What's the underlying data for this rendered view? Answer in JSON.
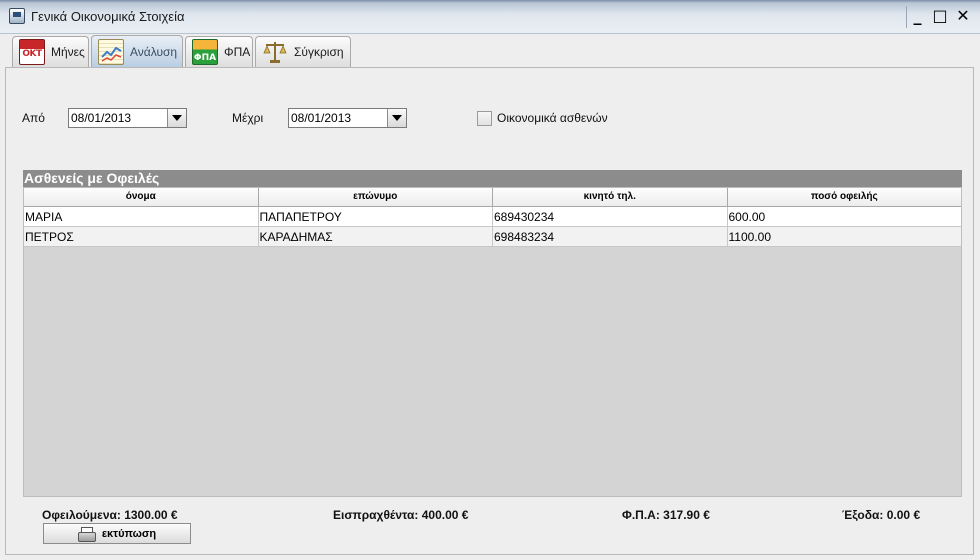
{
  "window": {
    "title": "Γενικά Οικονομικά Στοιχεία",
    "minimize": "_",
    "maximize": "□",
    "close": "✕"
  },
  "tabs": [
    {
      "label": "Μήνες",
      "icon": "calendar-icon",
      "icon_text": "ΟΚΤ",
      "active": false
    },
    {
      "label": "Ανάλυση",
      "icon": "chart-icon",
      "active": true
    },
    {
      "label": "ΦΠΑ",
      "icon": "vat-icon",
      "icon_text": "ΦΠΑ",
      "active": false
    },
    {
      "label": "Σύγκριση",
      "icon": "scale-icon",
      "active": false
    }
  ],
  "filters": {
    "from_label": "Από",
    "from_value": "08/01/2013",
    "to_label": "Μέχρι",
    "to_value": "08/01/2013",
    "checkbox_label": "Οικονομικά ασθενών",
    "checkbox_checked": false
  },
  "table": {
    "title": "Ασθενείς με Οφειλές",
    "columns": [
      "όνομα",
      "επώνυμο",
      "κινητό τηλ.",
      "ποσό οφειλής"
    ],
    "rows": [
      [
        "ΜΑΡΙΑ",
        "ΠΑΠΑΠΕΤΡΟΥ",
        "689430234",
        "600.00"
      ],
      [
        "ΠΕΤΡΟΣ",
        "ΚΑΡΑΔΗΜΑΣ",
        "698483234",
        "1100.00"
      ]
    ]
  },
  "footer": {
    "owed": "Οφειλούμενα: 1300.00 €",
    "collected": "Εισπραχθέντα: 400.00 €",
    "vat": "Φ.Π.Α: 317.90 €",
    "expenses": "Έξοδα: 0.00 €",
    "print_label": "εκτύπωση"
  }
}
